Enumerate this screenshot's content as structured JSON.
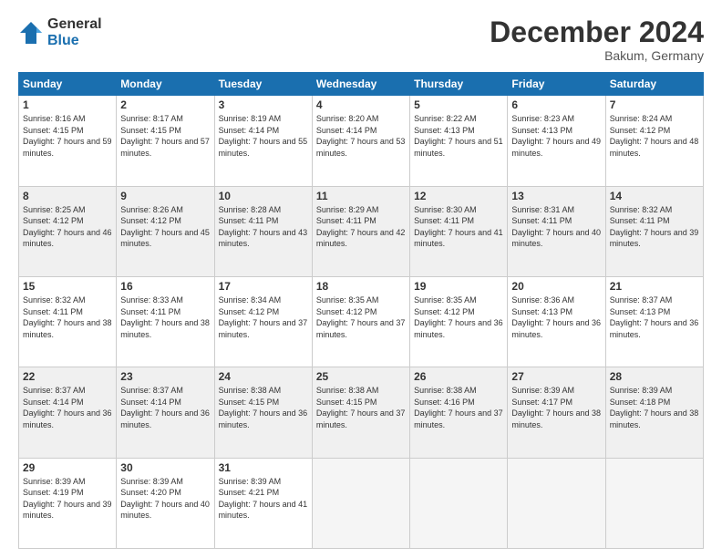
{
  "header": {
    "logo_general": "General",
    "logo_blue": "Blue",
    "month_title": "December 2024",
    "location": "Bakum, Germany"
  },
  "days_of_week": [
    "Sunday",
    "Monday",
    "Tuesday",
    "Wednesday",
    "Thursday",
    "Friday",
    "Saturday"
  ],
  "weeks": [
    [
      {
        "day": "1",
        "sunrise": "8:16 AM",
        "sunset": "4:15 PM",
        "daylight": "7 hours and 59 minutes."
      },
      {
        "day": "2",
        "sunrise": "8:17 AM",
        "sunset": "4:15 PM",
        "daylight": "7 hours and 57 minutes."
      },
      {
        "day": "3",
        "sunrise": "8:19 AM",
        "sunset": "4:14 PM",
        "daylight": "7 hours and 55 minutes."
      },
      {
        "day": "4",
        "sunrise": "8:20 AM",
        "sunset": "4:14 PM",
        "daylight": "7 hours and 53 minutes."
      },
      {
        "day": "5",
        "sunrise": "8:22 AM",
        "sunset": "4:13 PM",
        "daylight": "7 hours and 51 minutes."
      },
      {
        "day": "6",
        "sunrise": "8:23 AM",
        "sunset": "4:13 PM",
        "daylight": "7 hours and 49 minutes."
      },
      {
        "day": "7",
        "sunrise": "8:24 AM",
        "sunset": "4:12 PM",
        "daylight": "7 hours and 48 minutes."
      }
    ],
    [
      {
        "day": "8",
        "sunrise": "8:25 AM",
        "sunset": "4:12 PM",
        "daylight": "7 hours and 46 minutes."
      },
      {
        "day": "9",
        "sunrise": "8:26 AM",
        "sunset": "4:12 PM",
        "daylight": "7 hours and 45 minutes."
      },
      {
        "day": "10",
        "sunrise": "8:28 AM",
        "sunset": "4:11 PM",
        "daylight": "7 hours and 43 minutes."
      },
      {
        "day": "11",
        "sunrise": "8:29 AM",
        "sunset": "4:11 PM",
        "daylight": "7 hours and 42 minutes."
      },
      {
        "day": "12",
        "sunrise": "8:30 AM",
        "sunset": "4:11 PM",
        "daylight": "7 hours and 41 minutes."
      },
      {
        "day": "13",
        "sunrise": "8:31 AM",
        "sunset": "4:11 PM",
        "daylight": "7 hours and 40 minutes."
      },
      {
        "day": "14",
        "sunrise": "8:32 AM",
        "sunset": "4:11 PM",
        "daylight": "7 hours and 39 minutes."
      }
    ],
    [
      {
        "day": "15",
        "sunrise": "8:32 AM",
        "sunset": "4:11 PM",
        "daylight": "7 hours and 38 minutes."
      },
      {
        "day": "16",
        "sunrise": "8:33 AM",
        "sunset": "4:11 PM",
        "daylight": "7 hours and 38 minutes."
      },
      {
        "day": "17",
        "sunrise": "8:34 AM",
        "sunset": "4:12 PM",
        "daylight": "7 hours and 37 minutes."
      },
      {
        "day": "18",
        "sunrise": "8:35 AM",
        "sunset": "4:12 PM",
        "daylight": "7 hours and 37 minutes."
      },
      {
        "day": "19",
        "sunrise": "8:35 AM",
        "sunset": "4:12 PM",
        "daylight": "7 hours and 36 minutes."
      },
      {
        "day": "20",
        "sunrise": "8:36 AM",
        "sunset": "4:13 PM",
        "daylight": "7 hours and 36 minutes."
      },
      {
        "day": "21",
        "sunrise": "8:37 AM",
        "sunset": "4:13 PM",
        "daylight": "7 hours and 36 minutes."
      }
    ],
    [
      {
        "day": "22",
        "sunrise": "8:37 AM",
        "sunset": "4:14 PM",
        "daylight": "7 hours and 36 minutes."
      },
      {
        "day": "23",
        "sunrise": "8:37 AM",
        "sunset": "4:14 PM",
        "daylight": "7 hours and 36 minutes."
      },
      {
        "day": "24",
        "sunrise": "8:38 AM",
        "sunset": "4:15 PM",
        "daylight": "7 hours and 36 minutes."
      },
      {
        "day": "25",
        "sunrise": "8:38 AM",
        "sunset": "4:15 PM",
        "daylight": "7 hours and 37 minutes."
      },
      {
        "day": "26",
        "sunrise": "8:38 AM",
        "sunset": "4:16 PM",
        "daylight": "7 hours and 37 minutes."
      },
      {
        "day": "27",
        "sunrise": "8:39 AM",
        "sunset": "4:17 PM",
        "daylight": "7 hours and 38 minutes."
      },
      {
        "day": "28",
        "sunrise": "8:39 AM",
        "sunset": "4:18 PM",
        "daylight": "7 hours and 38 minutes."
      }
    ],
    [
      {
        "day": "29",
        "sunrise": "8:39 AM",
        "sunset": "4:19 PM",
        "daylight": "7 hours and 39 minutes."
      },
      {
        "day": "30",
        "sunrise": "8:39 AM",
        "sunset": "4:20 PM",
        "daylight": "7 hours and 40 minutes."
      },
      {
        "day": "31",
        "sunrise": "8:39 AM",
        "sunset": "4:21 PM",
        "daylight": "7 hours and 41 minutes."
      },
      null,
      null,
      null,
      null
    ]
  ]
}
